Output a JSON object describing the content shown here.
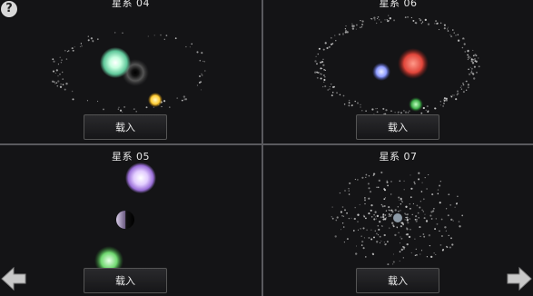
{
  "systems": [
    {
      "title": "星系 04",
      "load_label": "载入"
    },
    {
      "title": "星系 06",
      "load_label": "载入"
    },
    {
      "title": "星系 05",
      "load_label": "载入"
    },
    {
      "title": "星系 07",
      "load_label": "载入"
    }
  ],
  "help": {
    "glyph": "?",
    "icon": "help-icon"
  },
  "navigation": {
    "prev_icon": "arrow-left-icon",
    "next_icon": "arrow-right-icon"
  },
  "colors": {
    "background": "#141416",
    "divider": "#5a5a5e",
    "planet_green": "#9ff0c0",
    "planet_yellow": "#ffd24a",
    "planet_blue": "#8f9cff",
    "planet_red": "#e0453a",
    "planet_purple": "#d8b8ff"
  }
}
